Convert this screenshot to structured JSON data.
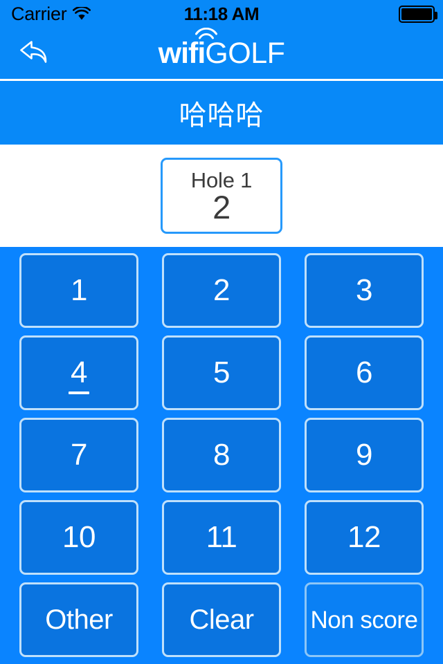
{
  "status_bar": {
    "carrier": "Carrier",
    "wifi_icon": "wifi-icon",
    "time": "11:18 AM",
    "battery_icon": "battery-full-icon"
  },
  "nav_bar": {
    "back_icon": "back-arrow-icon",
    "brand_primary": "wifi",
    "brand_secondary": "GOLF",
    "brand_arc_icon": "wifi-arc-icon"
  },
  "title_bar": {
    "title": "哈哈哈"
  },
  "score_panel": {
    "hole_label": "Hole 1",
    "score_value": "2"
  },
  "keypad": {
    "rows": [
      [
        {
          "label": "1",
          "name": "key-1",
          "par": false,
          "muted": false,
          "style": "number"
        },
        {
          "label": "2",
          "name": "key-2",
          "par": false,
          "muted": false,
          "style": "number"
        },
        {
          "label": "3",
          "name": "key-3",
          "par": false,
          "muted": false,
          "style": "number"
        }
      ],
      [
        {
          "label": "4",
          "name": "key-4",
          "par": true,
          "muted": false,
          "style": "number"
        },
        {
          "label": "5",
          "name": "key-5",
          "par": false,
          "muted": false,
          "style": "number"
        },
        {
          "label": "6",
          "name": "key-6",
          "par": false,
          "muted": false,
          "style": "number"
        }
      ],
      [
        {
          "label": "7",
          "name": "key-7",
          "par": false,
          "muted": false,
          "style": "number"
        },
        {
          "label": "8",
          "name": "key-8",
          "par": false,
          "muted": false,
          "style": "number"
        },
        {
          "label": "9",
          "name": "key-9",
          "par": false,
          "muted": false,
          "style": "number"
        }
      ],
      [
        {
          "label": "10",
          "name": "key-10",
          "par": false,
          "muted": false,
          "style": "number"
        },
        {
          "label": "11",
          "name": "key-11",
          "par": false,
          "muted": false,
          "style": "number"
        },
        {
          "label": "12",
          "name": "key-12",
          "par": false,
          "muted": false,
          "style": "number"
        }
      ],
      [
        {
          "label": "Other",
          "name": "key-other",
          "par": false,
          "muted": false,
          "style": "word"
        },
        {
          "label": "Clear",
          "name": "key-clear",
          "par": false,
          "muted": false,
          "style": "word"
        },
        {
          "label": "Non score",
          "name": "key-non-score",
          "par": false,
          "muted": true,
          "style": "small"
        }
      ]
    ]
  },
  "colors": {
    "nav_blue": "#0889f8",
    "keypad_blue": "#0a84ff",
    "key_blue": "#0a74e0",
    "key_border": "#bfe0fb",
    "score_border": "#2699fb",
    "text_dark": "#3b3b3b",
    "white": "#ffffff"
  }
}
